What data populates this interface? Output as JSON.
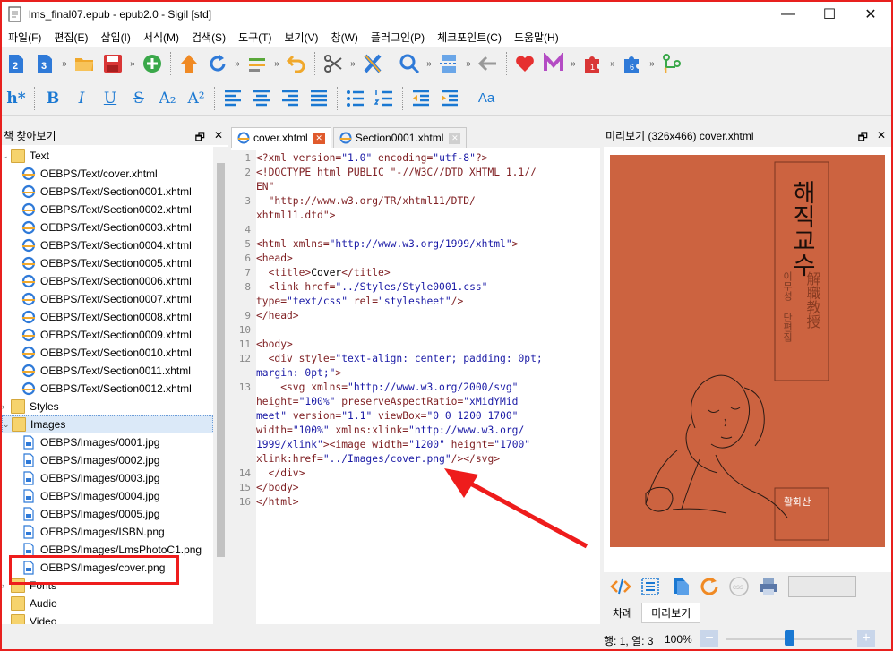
{
  "window": {
    "title": "lms_final07.epub - epub2.0 - Sigil [std]",
    "minimize": "—",
    "maximize": "☐",
    "close": "✕"
  },
  "menu": [
    "파일(F)",
    "편집(E)",
    "삽입(I)",
    "서식(M)",
    "검색(S)",
    "도구(T)",
    "보기(V)",
    "창(W)",
    "플러그인(P)",
    "체크포인트(C)",
    "도움말(H)"
  ],
  "toolbar_format": {
    "heading": "h*",
    "bold": "B",
    "italic": "I",
    "underline": "U",
    "strike": "S",
    "subscript": "A₂",
    "superscript": "A²",
    "case": "Aa"
  },
  "plugin_badges": {
    "first": "1",
    "second": "6",
    "third": "1"
  },
  "browser": {
    "title": "책 찾아보기",
    "float": "🗗",
    "close": "✕",
    "items": [
      {
        "kind": "folder",
        "label": "Text",
        "expander": "⌄"
      },
      {
        "kind": "html",
        "label": "OEBPS/Text/cover.xhtml"
      },
      {
        "kind": "html",
        "label": "OEBPS/Text/Section0001.xhtml"
      },
      {
        "kind": "html",
        "label": "OEBPS/Text/Section0002.xhtml"
      },
      {
        "kind": "html",
        "label": "OEBPS/Text/Section0003.xhtml"
      },
      {
        "kind": "html",
        "label": "OEBPS/Text/Section0004.xhtml"
      },
      {
        "kind": "html",
        "label": "OEBPS/Text/Section0005.xhtml"
      },
      {
        "kind": "html",
        "label": "OEBPS/Text/Section0006.xhtml"
      },
      {
        "kind": "html",
        "label": "OEBPS/Text/Section0007.xhtml"
      },
      {
        "kind": "html",
        "label": "OEBPS/Text/Section0008.xhtml"
      },
      {
        "kind": "html",
        "label": "OEBPS/Text/Section0009.xhtml"
      },
      {
        "kind": "html",
        "label": "OEBPS/Text/Section0010.xhtml"
      },
      {
        "kind": "html",
        "label": "OEBPS/Text/Section0011.xhtml"
      },
      {
        "kind": "html",
        "label": "OEBPS/Text/Section0012.xhtml"
      },
      {
        "kind": "folder",
        "label": "Styles",
        "expander": "›"
      },
      {
        "kind": "folder",
        "label": "Images",
        "expander": "⌄",
        "selected": true
      },
      {
        "kind": "img",
        "label": "OEBPS/Images/0001.jpg"
      },
      {
        "kind": "img",
        "label": "OEBPS/Images/0002.jpg"
      },
      {
        "kind": "img",
        "label": "OEBPS/Images/0003.jpg"
      },
      {
        "kind": "img",
        "label": "OEBPS/Images/0004.jpg"
      },
      {
        "kind": "img",
        "label": "OEBPS/Images/0005.jpg"
      },
      {
        "kind": "img",
        "label": "OEBPS/Images/ISBN.png"
      },
      {
        "kind": "img",
        "label": "OEBPS/Images/LmsPhotoC1.png"
      },
      {
        "kind": "img",
        "label": "OEBPS/Images/cover.png"
      },
      {
        "kind": "folder",
        "label": "Fonts",
        "expander": "›"
      },
      {
        "kind": "folder",
        "label": "Audio",
        "expander": ""
      },
      {
        "kind": "folder",
        "label": "Video",
        "expander": ""
      }
    ]
  },
  "editor": {
    "tabs": [
      {
        "label": "cover.xhtml",
        "active": true,
        "close": "✕"
      },
      {
        "label": "Section0001.xhtml",
        "active": false,
        "close": "✕"
      }
    ],
    "line_numbers": [
      "1",
      "2",
      "",
      "3",
      "",
      "4",
      "5",
      "6",
      "7",
      "8",
      "",
      "9",
      "10",
      "11",
      "12",
      "",
      "13",
      "",
      "",
      "",
      "",
      "",
      "14",
      "15",
      "16"
    ],
    "lines": [
      [
        [
          "c-tag",
          "<?xml "
        ],
        [
          "c-attr",
          "version="
        ],
        [
          "c-val",
          "\"1.0\""
        ],
        [
          "c-attr",
          " encoding="
        ],
        [
          "c-val",
          "\"utf-8\""
        ],
        [
          "c-tag",
          "?>"
        ]
      ],
      [
        [
          "c-tag",
          "<!DOCTYPE html PUBLIC \"-//W3C//DTD XHTML 1.1//"
        ]
      ],
      [
        [
          "c-tag",
          "EN\""
        ]
      ],
      [
        [
          "c-tag",
          "  \"http://www.w3.org/TR/xhtml11/DTD/"
        ]
      ],
      [
        [
          "c-tag",
          "xhtml11.dtd\">"
        ]
      ],
      [
        [
          "c-txt",
          ""
        ]
      ],
      [
        [
          "c-tag",
          "<html "
        ],
        [
          "c-attr",
          "xmlns="
        ],
        [
          "c-val",
          "\"http://www.w3.org/1999/xhtml\""
        ],
        [
          "c-tag",
          ">"
        ]
      ],
      [
        [
          "c-tag",
          "<head>"
        ]
      ],
      [
        [
          "c-tag",
          "  <title>"
        ],
        [
          "c-txt",
          "Cover"
        ],
        [
          "c-tag",
          "</title>"
        ]
      ],
      [
        [
          "c-tag",
          "  <link "
        ],
        [
          "c-attr",
          "href="
        ],
        [
          "c-val",
          "\"../Styles/Style0001.css\""
        ]
      ],
      [
        [
          "c-attr",
          "type="
        ],
        [
          "c-val",
          "\"text/css\""
        ],
        [
          "c-attr",
          " rel="
        ],
        [
          "c-val",
          "\"stylesheet\""
        ],
        [
          "c-tag",
          "/>"
        ]
      ],
      [
        [
          "c-tag",
          "</head>"
        ]
      ],
      [
        [
          "c-txt",
          ""
        ]
      ],
      [
        [
          "c-tag",
          "<body>"
        ]
      ],
      [
        [
          "c-tag",
          "  <div "
        ],
        [
          "c-attr",
          "style="
        ],
        [
          "c-val",
          "\"text-align: center; padding: 0pt;"
        ]
      ],
      [
        [
          "c-val",
          "margin: 0pt;\""
        ],
        [
          "c-tag",
          ">"
        ]
      ],
      [
        [
          "c-tag",
          "    <svg "
        ],
        [
          "c-attr",
          "xmlns="
        ],
        [
          "c-val",
          "\"http://www.w3.org/2000/svg\""
        ]
      ],
      [
        [
          "c-attr",
          "height="
        ],
        [
          "c-val",
          "\"100%\""
        ],
        [
          "c-attr",
          " preserveAspectRatio="
        ],
        [
          "c-val",
          "\"xMidYMid"
        ]
      ],
      [
        [
          "c-val",
          "meet\""
        ],
        [
          "c-attr",
          " version="
        ],
        [
          "c-val",
          "\"1.1\""
        ],
        [
          "c-attr",
          " viewBox="
        ],
        [
          "c-val",
          "\"0 0 1200 1700\""
        ]
      ],
      [
        [
          "c-attr",
          "width="
        ],
        [
          "c-val",
          "\"100%\""
        ],
        [
          "c-attr",
          " xmlns:xlink="
        ],
        [
          "c-val",
          "\"http://www.w3.org/"
        ]
      ],
      [
        [
          "c-val",
          "1999/xlink\""
        ],
        [
          "c-tag",
          "><image "
        ],
        [
          "c-attr",
          "width="
        ],
        [
          "c-val",
          "\"1200\""
        ],
        [
          "c-attr",
          " height="
        ],
        [
          "c-val",
          "\"1700\""
        ]
      ],
      [
        [
          "c-attr",
          "xlink:href="
        ],
        [
          "c-val",
          "\"../Images/cover.png\""
        ],
        [
          "c-tag",
          "/></svg>"
        ]
      ],
      [
        [
          "c-tag",
          "  </div>"
        ]
      ],
      [
        [
          "c-tag",
          "</body>"
        ]
      ],
      [
        [
          "c-tag",
          "</html>"
        ]
      ]
    ]
  },
  "preview": {
    "title": "미리보기 (326x466) cover.xhtml",
    "float": "🗗",
    "close": "✕",
    "cover_title": "해직교수",
    "cover_hanja": "解職教授",
    "cover_author": "이무성 단편집",
    "cover_publisher": "활화산",
    "tabs": [
      "차례",
      "미리보기"
    ]
  },
  "status": {
    "position": "행: 1, 열: 3",
    "zoom": "100%",
    "zoom_out": "−",
    "zoom_in": "+",
    "zoom_level": 0.5
  },
  "colors": {
    "annotation_red": "#ee1c1c",
    "cover_bg": "#cc6340",
    "accent_blue": "#1a78d2"
  }
}
